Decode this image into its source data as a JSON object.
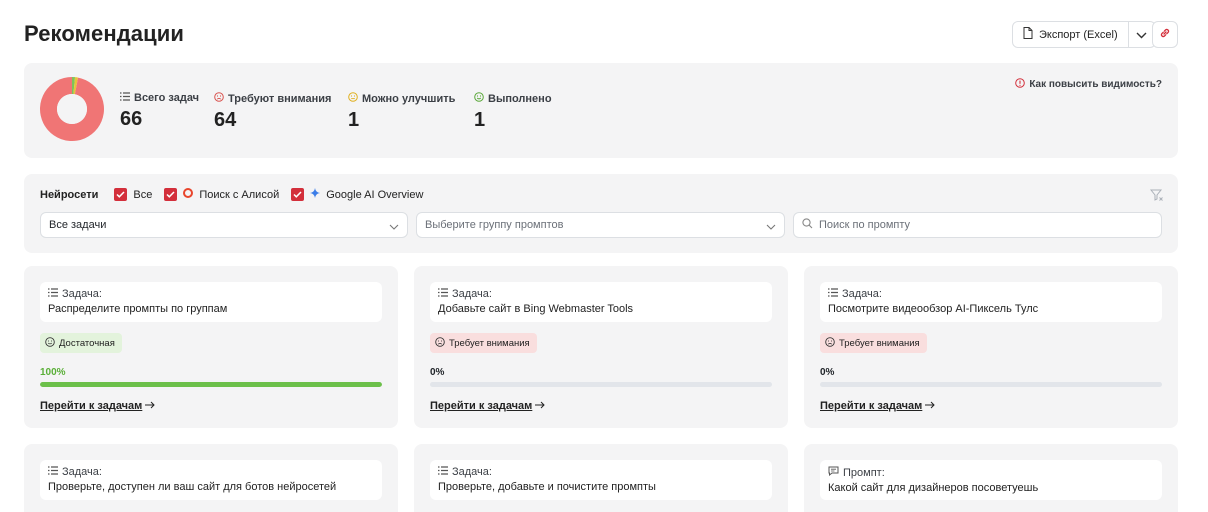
{
  "header": {
    "title": "Рекомендации",
    "export_label": "Экспорт (Excel)"
  },
  "stats": {
    "total": {
      "label": "Всего задач",
      "value": "66"
    },
    "attention": {
      "label": "Требуют внимания",
      "value": "64"
    },
    "improve": {
      "label": "Можно улучшить",
      "value": "1"
    },
    "done": {
      "label": "Выполнено",
      "value": "1"
    },
    "visibility_link": "Как повысить видимость?",
    "colors": {
      "attention": "#f07575",
      "improve": "#e8c43a",
      "done": "#7dc45a"
    }
  },
  "filters": {
    "title": "Нейросети",
    "checkboxes": [
      {
        "label": "Все",
        "checked": true
      },
      {
        "label": "Поиск с Алисой",
        "checked": true
      },
      {
        "label": "Google AI Overview",
        "checked": true
      }
    ],
    "task_select": "Все задачи",
    "group_placeholder": "Выберите группу промптов",
    "search_placeholder": "Поиск по промпту"
  },
  "cards": [
    {
      "head": "Задача:",
      "text": "Распределите промпты по группам",
      "badge": "Достаточная",
      "status": "ok",
      "progress_label": "100%",
      "progress": 100,
      "link": "Перейти к задачам"
    },
    {
      "head": "Задача:",
      "text": "Добавьте сайт в Bing Webmaster Tools",
      "badge": "Требует внимания",
      "status": "bad",
      "progress_label": "0%",
      "progress": 0,
      "link": "Перейти к задачам"
    },
    {
      "head": "Задача:",
      "text": "Посмотрите видеообзор AI-Пиксель Тулс",
      "badge": "Требует внимания",
      "status": "bad",
      "progress_label": "0%",
      "progress": 0,
      "link": "Перейти к задачам"
    },
    {
      "head": "Задача:",
      "text": "Проверьте, доступен ли ваш сайт для ботов нейросетей"
    },
    {
      "head": "Задача:",
      "text": "Проверьте, добавьте и почистите промпты"
    },
    {
      "head": "Промпт:",
      "text": "Какой сайт для дизайнеров посоветуешь"
    }
  ],
  "colors": {
    "accent_red": "#d32f3b",
    "progress_green": "#6cc04a",
    "card_bg": "#f4f4f5"
  }
}
